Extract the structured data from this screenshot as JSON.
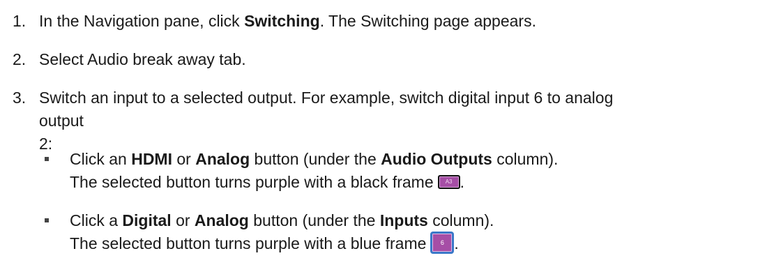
{
  "steps": [
    {
      "number": "1.",
      "before": "In the Navigation pane, click ",
      "bold": "Switching",
      "after": ". The Switching page appears."
    },
    {
      "number": "2.",
      "text": "Select Audio break away tab."
    },
    {
      "number": "3.",
      "line1": "Switch an input to a selected output. For example, switch digital input 6 to analog",
      "line2": "output 2:"
    }
  ],
  "bullets": [
    {
      "p1": "Click an ",
      "b1": "HDMI",
      "p2": " or ",
      "b2": "Analog",
      "p3": " button (under the ",
      "b3": "Audio Outputs",
      "p4": " column).",
      "line2": "The selected button turns purple with a black frame",
      "button_label": "A3",
      "end": "."
    },
    {
      "p1": "Click a ",
      "b1": "Digital",
      "p2": " or ",
      "b2": "Analog",
      "p3": " button (under the ",
      "b3": "Inputs",
      "p4": " column).",
      "line2": "The selected button turns purple with a blue frame",
      "button_label": "6",
      "end": "."
    }
  ],
  "colors": {
    "button_fill": "#a64ea6",
    "black_frame": "#111111",
    "blue_frame": "#3a78c8"
  },
  "icons": {
    "bullet": "square-bullet",
    "inline_button_1": "purple-button-black-frame",
    "inline_button_2": "purple-button-blue-frame"
  }
}
